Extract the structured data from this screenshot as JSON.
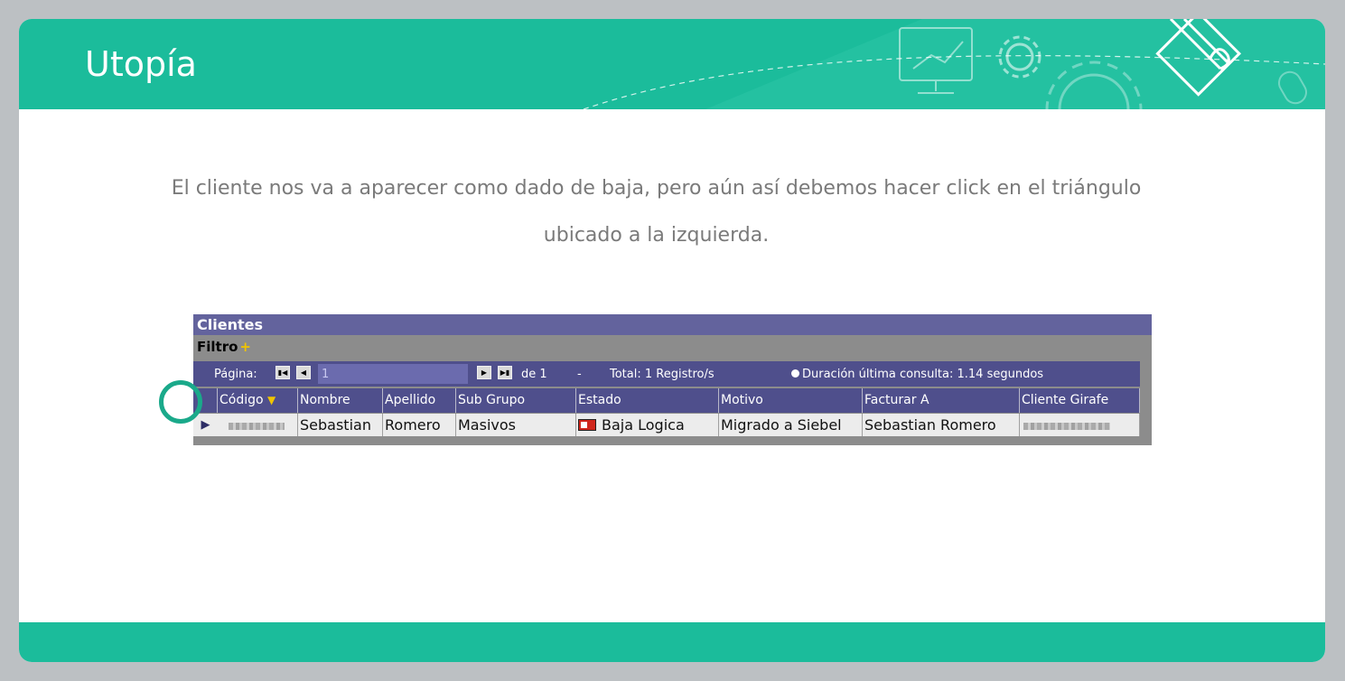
{
  "slide": {
    "title": "Utopía",
    "instruction": "El cliente nos va a aparecer como dado de baja, pero aún así debemos hacer click en el triángulo ubicado a la izquierda.",
    "accent_color": "#1bbc9b"
  },
  "panel": {
    "title": "Clientes",
    "filter_label": "Filtro",
    "filter_icon": "plus-icon",
    "pager": {
      "page_label": "Página:",
      "page_value": "1",
      "of_label": "de 1",
      "separator": "-",
      "total": "Total: 1 Registro/s",
      "duration": "Duración última consulta: 1.14 segundos"
    },
    "columns": [
      "Código",
      "Nombre",
      "Apellido",
      "Sub Grupo",
      "Estado",
      "Motivo",
      "Facturar A",
      "Cliente Girafe"
    ],
    "row": {
      "nombre": "Sebastian",
      "apellido": "Romero",
      "sub_grupo": "Masivos",
      "estado": "Baja Logica",
      "motivo": "Migrado a Siebel",
      "facturar_a": "Sebastian Romero"
    }
  }
}
